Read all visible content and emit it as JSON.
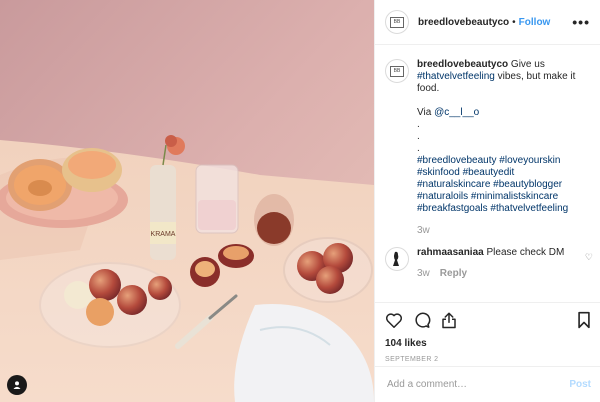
{
  "post": {
    "username": "breedlovebeautyco",
    "follow_label": "Follow",
    "dot": "•",
    "more_label": "•••",
    "avatar_logo_text": "BB",
    "caption": {
      "username": "breedlovebeautyco",
      "text_1": " Give us ",
      "tag_1": "#thatvelvetfeeling",
      "text_2": " vibes, but make it food.",
      "via": "Via ",
      "mention": "@c__l__o",
      "dot_lines": [
        ".",
        ".",
        "."
      ],
      "hashtags_1": "#breedlovebeauty #loveyourskin",
      "hashtags_2": "#skinfood #beautyedit",
      "hashtags_3": "#naturalskincare #beautyblogger",
      "hashtags_4": "#naturaloils #minimalistskincare",
      "hashtags_5": "#breakfastgoals #thatvelvetfeeling",
      "time": "3w"
    },
    "comment": {
      "username": "rahmaasaniaa",
      "text": " Please check DM",
      "time": "3w",
      "reply_label": "Reply"
    },
    "likes": "104 likes",
    "date": "SEPTEMBER 2",
    "add_comment_placeholder": "Add a comment…",
    "post_label": "Post"
  },
  "icons": {
    "heart": "heart-icon",
    "comment": "comment-icon",
    "share": "share-icon",
    "bookmark": "bookmark-icon",
    "user_tag": "user-tag-icon",
    "more": "more-options-icon"
  },
  "colors": {
    "link": "#3897f0",
    "hashtag": "#003569",
    "muted": "#999999",
    "border": "#efefef"
  }
}
